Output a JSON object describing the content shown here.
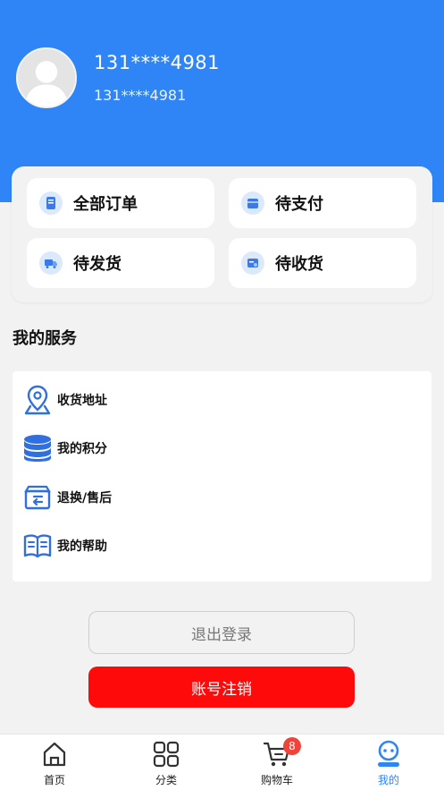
{
  "profile": {
    "name": "131****4981",
    "subtitle": "131****4981"
  },
  "orders": [
    {
      "label": "全部订单",
      "icon": "all-orders-icon"
    },
    {
      "label": "待支付",
      "icon": "pending-payment-icon"
    },
    {
      "label": "待发货",
      "icon": "pending-shipment-icon"
    },
    {
      "label": "待收货",
      "icon": "pending-receipt-icon"
    }
  ],
  "services": {
    "title": "我的服务",
    "items": [
      {
        "label": "收货地址",
        "icon": "location-pin-icon"
      },
      {
        "label": "我的积分",
        "icon": "coin-stack-icon"
      },
      {
        "label": "退换/售后",
        "icon": "return-box-icon"
      },
      {
        "label": "我的帮助",
        "icon": "book-icon"
      }
    ]
  },
  "actions": {
    "logout": "退出登录",
    "cancel_account": "账号注销"
  },
  "tabbar": {
    "items": [
      {
        "label": "首页",
        "icon": "home-icon"
      },
      {
        "label": "分类",
        "icon": "grid-icon"
      },
      {
        "label": "购物车",
        "icon": "cart-icon",
        "badge": "8"
      },
      {
        "label": "我的",
        "icon": "profile-icon"
      }
    ],
    "active_index": 3
  },
  "colors": {
    "header": "#2f85f6",
    "accent": "#2f85f6",
    "danger": "#ff0a0a",
    "badge": "#f0443a"
  }
}
